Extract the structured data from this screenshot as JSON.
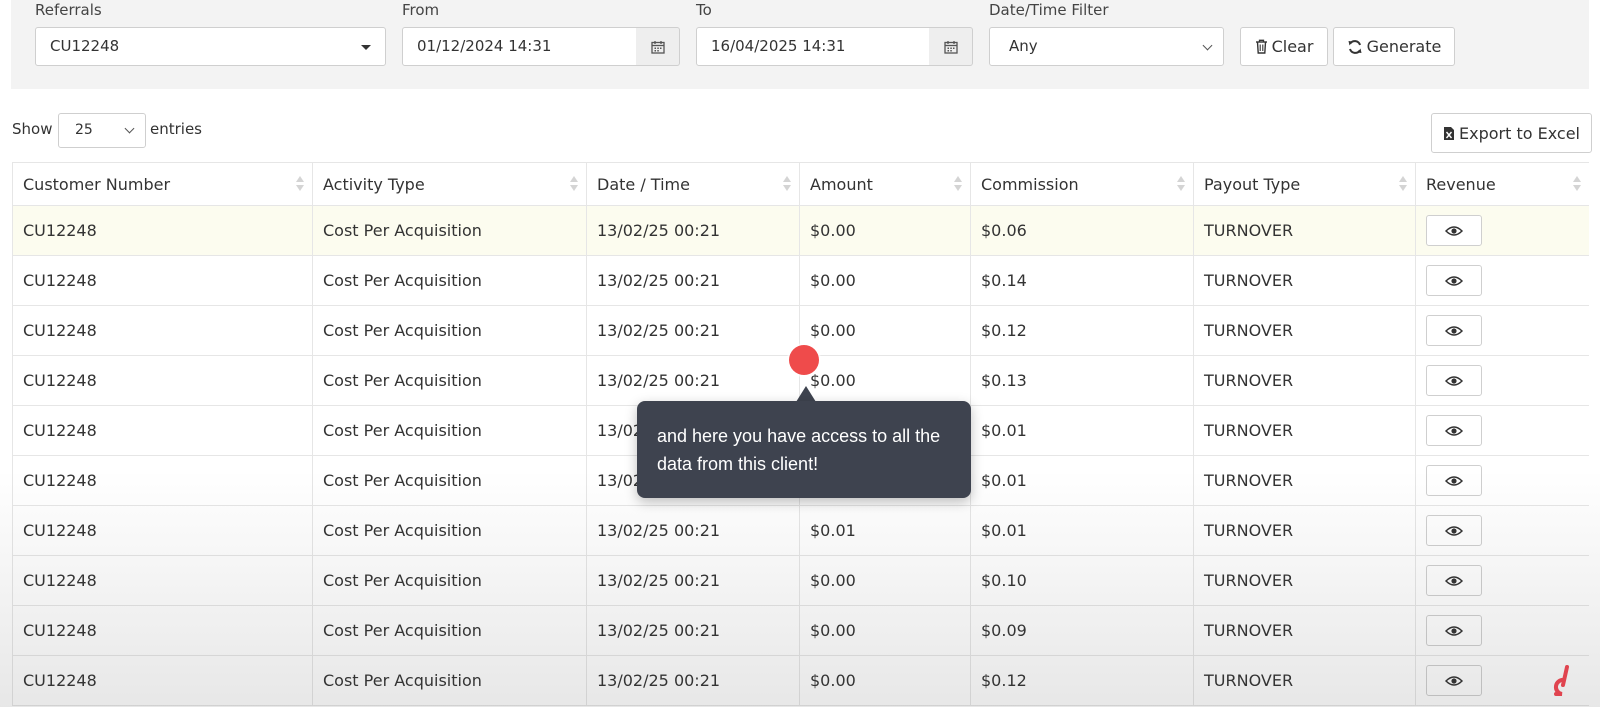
{
  "filters": {
    "referrals_label": "Referrals",
    "referrals_value": "CU12248",
    "from_label": "From",
    "from_value": "01/12/2024 14:31",
    "to_label": "To",
    "to_value": "16/04/2025 14:31",
    "datetime_filter_label": "Date/Time Filter",
    "datetime_filter_value": "Any",
    "clear_label": "Clear",
    "generate_label": "Generate"
  },
  "table_controls": {
    "show_label": "Show",
    "entries_value": "25",
    "entries_label": "entries",
    "export_label": "Export to Excel"
  },
  "table": {
    "headers": [
      "Customer Number",
      "Activity Type",
      "Date / Time",
      "Amount",
      "Commission",
      "Payout Type",
      "Revenue"
    ],
    "rows": [
      {
        "customer": "CU12248",
        "activity": "Cost Per Acquisition",
        "datetime": "13/02/25 00:21",
        "amount": "$0.00",
        "commission": "$0.06",
        "payout": "TURNOVER"
      },
      {
        "customer": "CU12248",
        "activity": "Cost Per Acquisition",
        "datetime": "13/02/25 00:21",
        "amount": "$0.00",
        "commission": "$0.14",
        "payout": "TURNOVER"
      },
      {
        "customer": "CU12248",
        "activity": "Cost Per Acquisition",
        "datetime": "13/02/25 00:21",
        "amount": "$0.00",
        "commission": "$0.12",
        "payout": "TURNOVER"
      },
      {
        "customer": "CU12248",
        "activity": "Cost Per Acquisition",
        "datetime": "13/02/25 00:21",
        "amount": "$0.00",
        "commission": "$0.13",
        "payout": "TURNOVER"
      },
      {
        "customer": "CU12248",
        "activity": "Cost Per Acquisition",
        "datetime": "13/02",
        "amount": "",
        "commission": "$0.01",
        "payout": "TURNOVER"
      },
      {
        "customer": "CU12248",
        "activity": "Cost Per Acquisition",
        "datetime": "13/02",
        "amount": "",
        "commission": "$0.01",
        "payout": "TURNOVER"
      },
      {
        "customer": "CU12248",
        "activity": "Cost Per Acquisition",
        "datetime": "13/02/25 00:21",
        "amount": "$0.01",
        "commission": "$0.01",
        "payout": "TURNOVER"
      },
      {
        "customer": "CU12248",
        "activity": "Cost Per Acquisition",
        "datetime": "13/02/25 00:21",
        "amount": "$0.00",
        "commission": "$0.10",
        "payout": "TURNOVER"
      },
      {
        "customer": "CU12248",
        "activity": "Cost Per Acquisition",
        "datetime": "13/02/25 00:21",
        "amount": "$0.00",
        "commission": "$0.09",
        "payout": "TURNOVER"
      },
      {
        "customer": "CU12248",
        "activity": "Cost Per Acquisition",
        "datetime": "13/02/25 00:21",
        "amount": "$0.00",
        "commission": "$0.12",
        "payout": "TURNOVER"
      }
    ]
  },
  "tooltip": {
    "text": "and here you have access to all the data from this client!"
  },
  "colors": {
    "tooltip_bg": "#3e434f",
    "cursor_dot": "#ef4b4b",
    "highlight_row": "#fcfcef",
    "brand_logo": "#e0444f"
  },
  "icons": {
    "dropdown": "caret-down-icon",
    "date_picker": "calendar-icon",
    "clear": "trash-icon",
    "generate": "refresh-icon",
    "export": "excel-file-icon",
    "revenue": "eye-icon",
    "sort": "sort-icon"
  }
}
